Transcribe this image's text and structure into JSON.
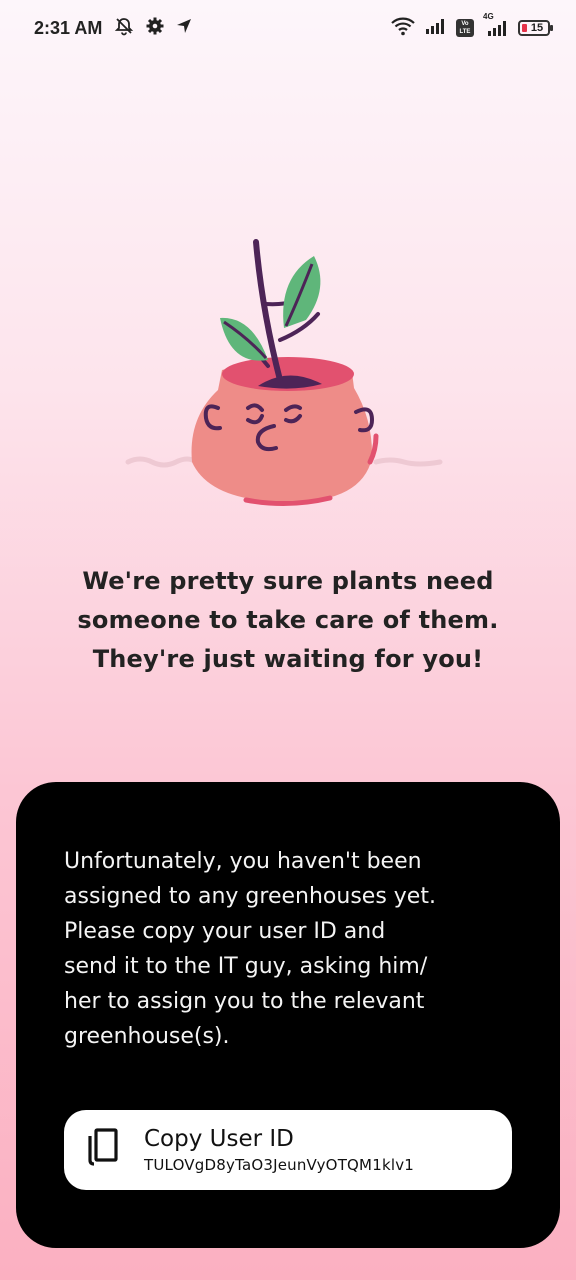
{
  "status_bar": {
    "time": "2:31 AM",
    "battery_level": "15",
    "network_label": "4G",
    "volte_label": "Vo LTE",
    "icons": [
      "muted-notifications-icon",
      "gear-icon",
      "navigation-arrow-icon",
      "wifi-icon",
      "signal-icon",
      "volte-icon",
      "signal-4g-icon",
      "battery-icon"
    ]
  },
  "message": {
    "line1": "We're pretty sure plants need",
    "line2": "someone to take care of them.",
    "line3": "They're just waiting for you!"
  },
  "card": {
    "line1": "Unfortunately,  you haven't been",
    "line2": "assigned to any greenhouses yet.",
    "line3": "Please copy your user ID and",
    "line4": "send it to the IT guy, asking him/",
    "line5": "her to assign you to the relevant",
    "line6": "greenhouse(s).",
    "copy_button": {
      "title": "Copy User ID",
      "user_id": "TULOVgD8yTaO3JeunVyOTQM1klv1",
      "icon": "copy-icon"
    }
  },
  "colors": {
    "background_top": "#fdf6fb",
    "background_bottom": "#fbb0c1",
    "card_background": "#000000",
    "pot": "#ee8c88",
    "pot_rim": "#e2516f",
    "leaf": "#5fb67a",
    "stem": "#4d2457"
  }
}
